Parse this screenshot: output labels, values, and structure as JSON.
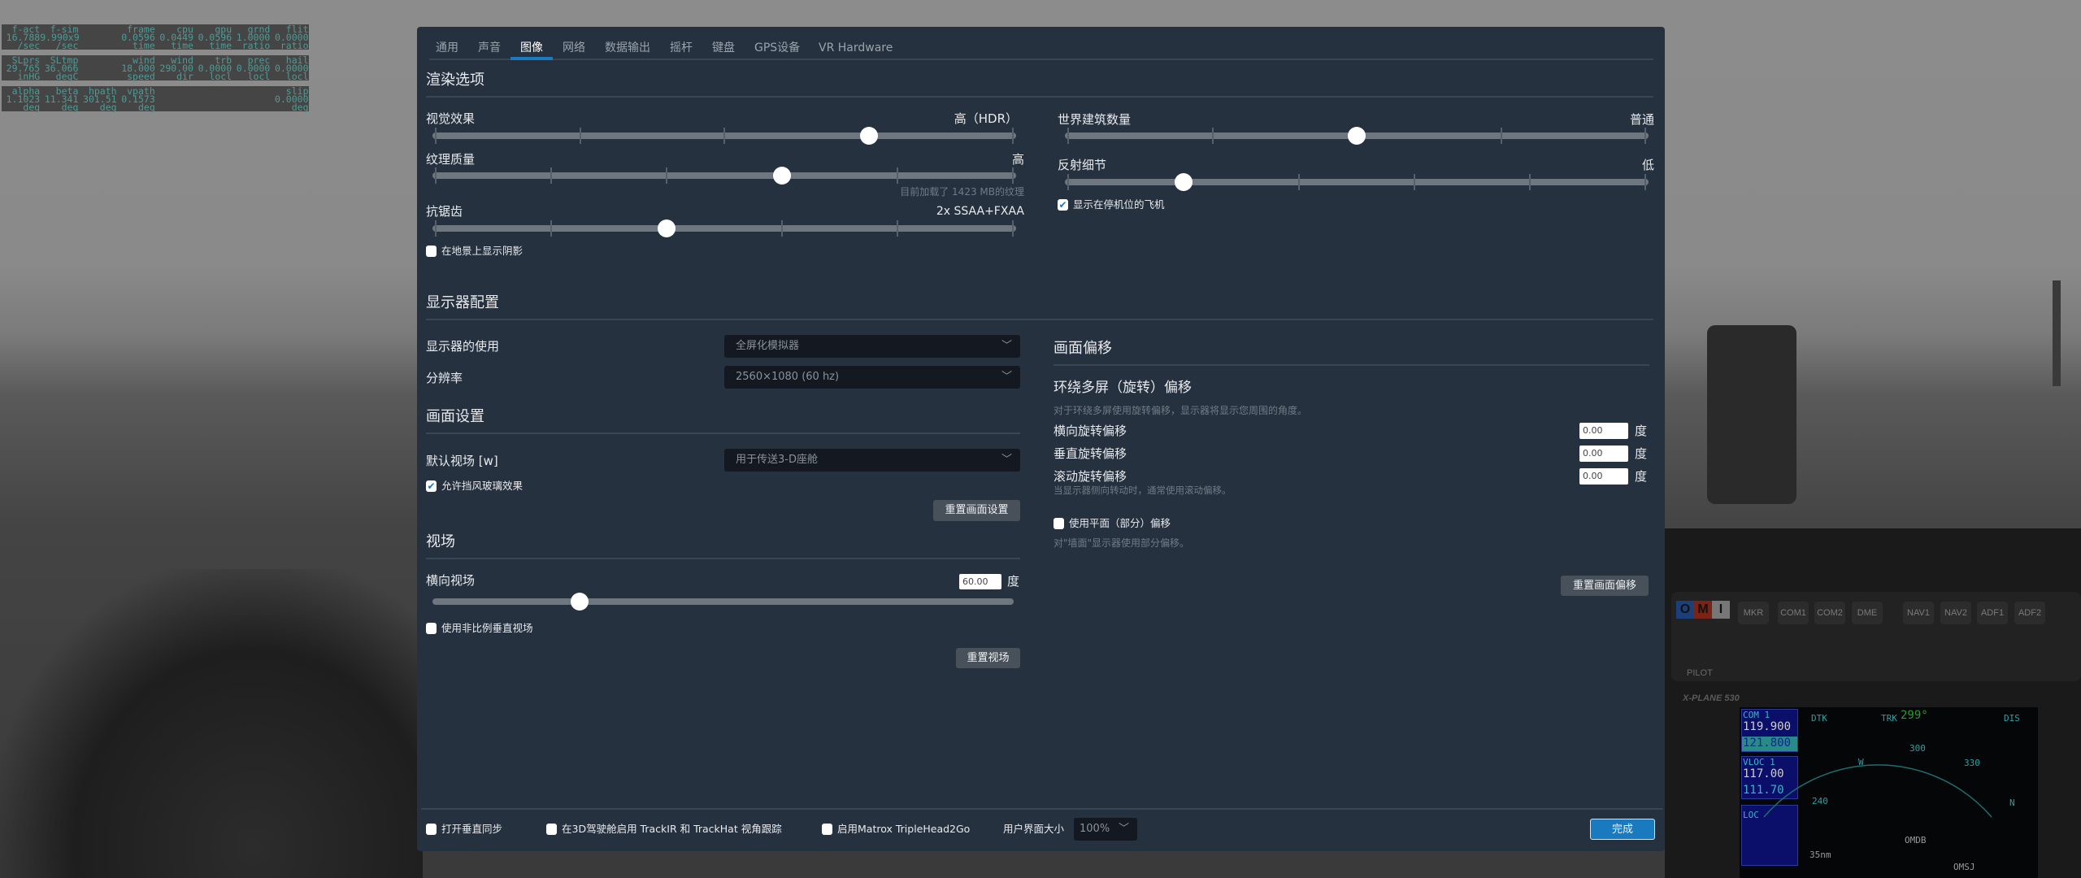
{
  "debug_overlay": [
    {
      "rows": [
        [
          "f-act",
          "f-sim",
          "",
          "frame",
          "cpu",
          "gpu",
          "grnd",
          "flit"
        ],
        [
          "16.788",
          "9.990x9",
          "",
          "0.0596",
          "0.0449",
          "0.0596",
          "1.0000",
          "0.0000"
        ],
        [
          "/sec",
          "/sec",
          "",
          "time",
          "time",
          "time",
          "ratio",
          "ratio"
        ]
      ]
    },
    {
      "rows": [
        [
          "SLprs",
          "SLtmp",
          "",
          "wind",
          "wind",
          "trb",
          "prec",
          "hail"
        ],
        [
          "29.765",
          "36.066",
          "",
          "18.000",
          "290.00",
          "0.0000",
          "0.0000",
          "0.0000"
        ],
        [
          "inHG",
          "degC",
          "",
          "speed",
          "dir",
          "locl",
          "locl",
          "locl"
        ]
      ]
    },
    {
      "rows": [
        [
          "alpha",
          "beta",
          "hpath",
          "vpath",
          "",
          "",
          "",
          "slip"
        ],
        [
          "1.1023",
          "11.341",
          "301.51",
          "0.1573",
          "",
          "",
          "",
          "0.0000"
        ],
        [
          "deg",
          "deg",
          "deg",
          "deg",
          "",
          "",
          "",
          "deg"
        ]
      ]
    }
  ],
  "cockpit": {
    "audio_buttons": [
      "MKR",
      "COM1",
      "COM2",
      "DME",
      "NAV1",
      "NAV2",
      "ADF1",
      "ADF2"
    ],
    "omi": [
      "O",
      "M",
      "I"
    ],
    "pilot_label": "PILOT",
    "gps_brand": "X-PLANE 530",
    "gps": {
      "com_label": "COM 1",
      "com_active": "119.900",
      "com_standby": "121.800",
      "vloc_label": "VLOC 1",
      "vloc_active": "117.00",
      "vloc_standby": "111.70",
      "loc": "LOC",
      "dtk": "DTK",
      "trk": "TRK",
      "trk_value": "299°",
      "dis": "DIS",
      "hdg_300": "300",
      "hdg_330": "330",
      "hdg_w": "W",
      "hdg_240": "240",
      "hdg_n": "N",
      "wpt1": "OMDB",
      "range": "35nm",
      "wpt2": "OMSJ"
    }
  },
  "tabs": [
    {
      "label": "通用",
      "active": false
    },
    {
      "label": "声音",
      "active": false
    },
    {
      "label": "图像",
      "active": true
    },
    {
      "label": "网络",
      "active": false
    },
    {
      "label": "数据输出",
      "active": false
    },
    {
      "label": "摇杆",
      "active": false
    },
    {
      "label": "键盘",
      "active": false
    },
    {
      "label": "GPS设备",
      "active": false
    },
    {
      "label": "VR Hardware",
      "active": false
    }
  ],
  "render": {
    "title": "渲染选项",
    "visual_effects": {
      "label": "视觉效果",
      "value": "高（HDR）",
      "steps": 5,
      "index": 3
    },
    "texture_quality": {
      "label": "纹理质量",
      "value": "高",
      "steps": 6,
      "index": 3,
      "note": "目前加载了 1423 MB的纹理"
    },
    "antialiasing": {
      "label": "抗锯齿",
      "value": "2x SSAA+FXAA",
      "steps": 6,
      "index": 2
    },
    "shadows_checkbox": {
      "label": "在地景上显示阴影",
      "checked": false
    },
    "world_objects": {
      "label": "世界建筑数量",
      "value": "普通",
      "steps": 5,
      "index": 2
    },
    "reflection_detail": {
      "label": "反射细节",
      "value": "低",
      "steps": 6,
      "index": 1
    },
    "parked_aircraft_checkbox": {
      "label": "显示在停机位的飞机",
      "checked": true
    }
  },
  "monitor": {
    "title": "显示器配置",
    "usage_label": "显示器的使用",
    "usage_value": "全屏化模拟器",
    "resolution_label": "分辨率",
    "resolution_value": "2560×1080 (60 hz)"
  },
  "view": {
    "title": "画面设置",
    "default_view_label": "默认视场 [w]",
    "default_view_value": "用于传送3-D座舱",
    "windshield_checkbox": {
      "label": "允许挡风玻璃效果",
      "checked": true
    },
    "reset_button": "重置画面设置"
  },
  "fov": {
    "title": "视场",
    "horizontal_label": "横向视场",
    "horizontal_value": "60.00",
    "unit": "度",
    "slider_fraction": 0.25,
    "nonprop_checkbox": {
      "label": "使用非比例垂直视场",
      "checked": false
    },
    "reset_button": "重置视场"
  },
  "offset": {
    "title": "画面偏移",
    "subtitle": "环绕多屏（旋转）偏移",
    "desc": "对于环绕多屏使用旋转偏移，显示器将显示您周围的角度。",
    "lateral_label": "横向旋转偏移",
    "lateral_value": "0.00",
    "vertical_label": "垂直旋转偏移",
    "vertical_value": "0.00",
    "roll_label": "滚动旋转偏移",
    "roll_value": "0.00",
    "unit": "度",
    "roll_note": "当显示器侧向转动时，通常使用滚动偏移。",
    "planar_checkbox": {
      "label": "使用平面（部分）偏移",
      "checked": false
    },
    "planar_note": "对\"墙面\"显示器使用部分偏移。",
    "reset_button": "重置画面偏移"
  },
  "footer": {
    "vsync": {
      "label": "打开垂直同步",
      "checked": false
    },
    "trackir": {
      "label": "在3D驾驶舱启用 TrackIR 和 TrackHat 视角跟踪",
      "checked": false
    },
    "matrox": {
      "label": "启用Matrox TripleHead2Go",
      "checked": false
    },
    "ui_size_label": "用户界面大小",
    "ui_size_value": "100%",
    "done_button": "完成"
  },
  "colors": {
    "dialog_bg": "#263140",
    "accent": "#1a7ac0",
    "overlay_text": "#4c9b96"
  }
}
